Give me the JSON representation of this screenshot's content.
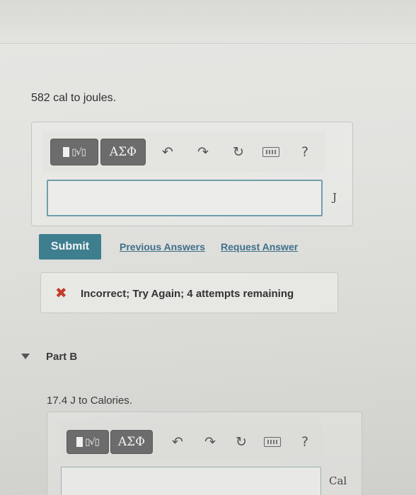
{
  "part_a": {
    "question": "582 cal to joules.",
    "toolbar": {
      "templates_icon": "templates-icon",
      "greek_label": "ΑΣΦ",
      "undo_icon": "undo-icon",
      "redo_icon": "redo-icon",
      "reset_icon": "reset-icon",
      "keyboard_icon": "keyboard-icon",
      "help_label": "?"
    },
    "answer_value": "",
    "unit": "J",
    "submit_label": "Submit",
    "previous_answers_label": "Previous Answers",
    "request_answer_label": "Request Answer",
    "feedback": {
      "icon": "x-icon",
      "symbol": "✖",
      "text": "Incorrect; Try Again; 4 attempts remaining",
      "color": "#c43b2a"
    }
  },
  "part_b": {
    "title": "Part B",
    "question": "17.4 J to Calories.",
    "toolbar": {
      "greek_label": "ΑΣΦ",
      "help_label": "?"
    },
    "answer_value": "",
    "unit": "Cal"
  },
  "colors": {
    "submit_bg": "#3d7e8f",
    "link": "#3f6f8a",
    "input_border": "#6f9eaa"
  }
}
